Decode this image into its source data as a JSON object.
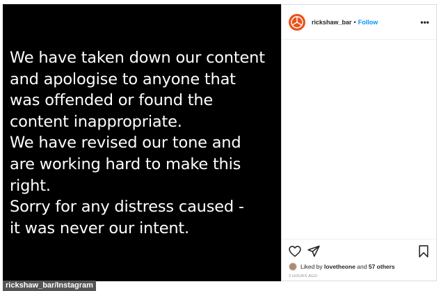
{
  "post_image": {
    "lines": [
      "We have taken down our content",
      "and apologise to anyone that",
      "was offended or found the",
      "content inappropriate.",
      "We have revised our tone and",
      "are working hard to make this",
      "right.",
      "Sorry for any distress caused -",
      "it was never our intent."
    ]
  },
  "header": {
    "username": "rickshaw_bar",
    "separator": "•",
    "follow_label": "Follow",
    "more_label": "•••",
    "avatar_color": "#e8541c"
  },
  "actions": {
    "icons": [
      "heart-icon",
      "share-icon",
      "bookmark-icon"
    ]
  },
  "likes": {
    "prefix": "Liked by",
    "user": "lovetheone",
    "and": "and",
    "others": "57 others"
  },
  "timestamp": "3 HOURS AGO",
  "credit": "rickshaw_bar/Instagram",
  "colors": {
    "follow_blue": "#0095f6",
    "border": "#dbdbdb",
    "credit_bg": "#555555"
  }
}
